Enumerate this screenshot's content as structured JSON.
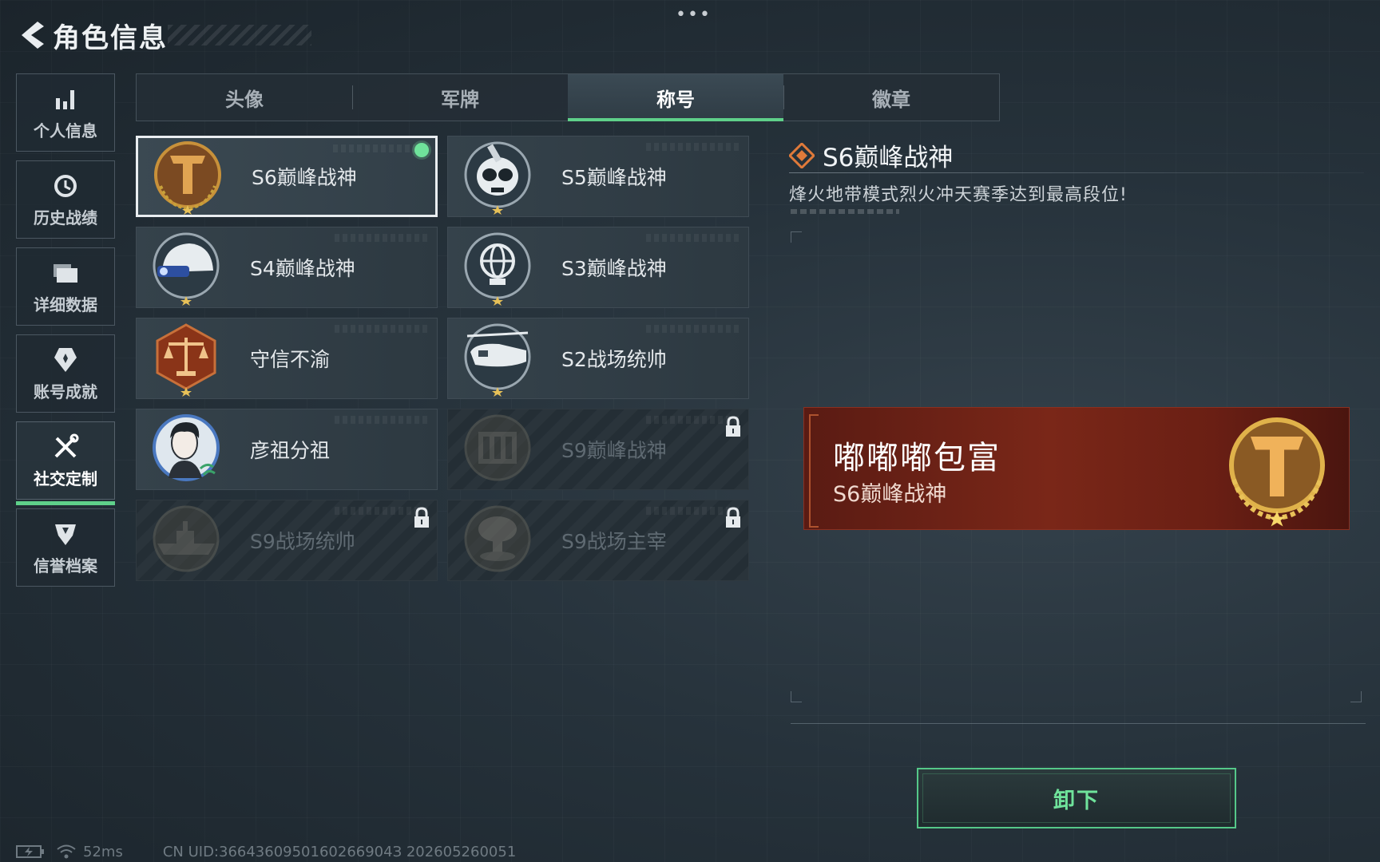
{
  "header": {
    "title": "角色信息",
    "more": "•••"
  },
  "sidebar": {
    "items": [
      {
        "label": "个人信息",
        "icon": "bar-chart-icon",
        "active": false
      },
      {
        "label": "历史战绩",
        "icon": "history-clock-icon",
        "active": false
      },
      {
        "label": "详细数据",
        "icon": "folder-icon",
        "active": false
      },
      {
        "label": "账号成就",
        "icon": "achievement-icon",
        "active": false
      },
      {
        "label": "社交定制",
        "icon": "tools-icon",
        "active": true
      },
      {
        "label": "信誉档案",
        "icon": "shield-badge-icon",
        "active": false
      }
    ]
  },
  "tabs": [
    {
      "label": "头像",
      "active": false
    },
    {
      "label": "军牌",
      "active": false
    },
    {
      "label": "称号",
      "active": true
    },
    {
      "label": "徽章",
      "active": false
    }
  ],
  "titles": [
    {
      "label": "S6巅峰战神",
      "badge": "gold-t-emblem-icon",
      "selected": true,
      "equipped": true,
      "locked": false
    },
    {
      "label": "S5巅峰战神",
      "badge": "skull-mask-emblem-icon",
      "selected": false,
      "equipped": false,
      "locked": false
    },
    {
      "label": "S4巅峰战神",
      "badge": "helmet-emblem-icon",
      "selected": false,
      "equipped": false,
      "locked": false
    },
    {
      "label": "S3巅峰战神",
      "badge": "globe-emblem-icon",
      "selected": false,
      "equipped": false,
      "locked": false
    },
    {
      "label": "守信不渝",
      "badge": "scales-emblem-icon",
      "selected": false,
      "equipped": false,
      "locked": false
    },
    {
      "label": "S2战场统帅",
      "badge": "helicopter-emblem-icon",
      "selected": false,
      "equipped": false,
      "locked": false
    },
    {
      "label": "彦祖分祖",
      "badge": "portrait-emblem-icon",
      "selected": false,
      "equipped": false,
      "locked": false
    },
    {
      "label": "S9巅峰战神",
      "badge": "building-emblem-icon",
      "selected": false,
      "equipped": false,
      "locked": true
    },
    {
      "label": "S9战场统帅",
      "badge": "warship-emblem-icon",
      "selected": false,
      "equipped": false,
      "locked": true
    },
    {
      "label": "S9战场主宰",
      "badge": "mushroom-cloud-emblem-icon",
      "selected": false,
      "equipped": false,
      "locked": true
    }
  ],
  "detail": {
    "title": "S6巅峰战神",
    "description": "烽火地带模式烈火冲天赛季达到最高段位!",
    "icon": "diamond-rank-icon"
  },
  "preview": {
    "player_name": "嘟嘟嘟包富",
    "title": "S6巅峰战神",
    "badge": "gold-t-emblem-icon"
  },
  "actions": {
    "unequip_label": "卸下"
  },
  "status": {
    "ping": "52ms",
    "uid_text": "CN UID:3664360950160266904З 202605260051"
  },
  "colors": {
    "accent_green": "#5fd08a",
    "preview_red": "#7a2718",
    "gold": "#c8913a"
  }
}
